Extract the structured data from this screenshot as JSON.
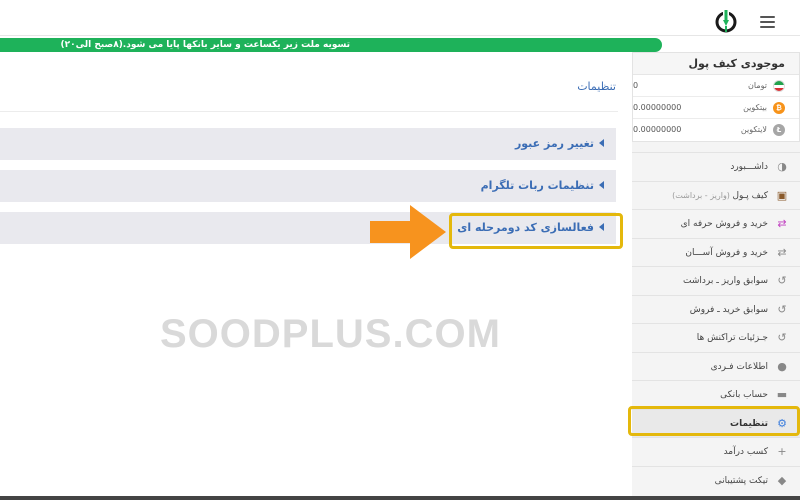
{
  "banner": {
    "text": "تسویه ملت زیر یکساعت و سایر بانکها پایا می شود.(۸صبح الی۲۰)",
    "color": "#1eb25a"
  },
  "header": {
    "logo_icon": "coin-plug-logo-icon",
    "menu_icon": "hamburger-menu-icon"
  },
  "wallet": {
    "title": "موجودی کیف پول",
    "currencies": [
      {
        "name": "تومان",
        "value": "0",
        "icon": "iran-flag-icon"
      },
      {
        "name": "بیتکوین",
        "value": "0.00000000",
        "icon": "bitcoin-icon"
      },
      {
        "name": "لایتکوین",
        "value": "0.00000000",
        "icon": "litecoin-icon"
      }
    ]
  },
  "sidebar": {
    "items": [
      {
        "label": "داشـــبورد",
        "sub": "",
        "icon": "dashboard-icon"
      },
      {
        "label": "کیف پـول",
        "sub": " (واریز - برداشت)",
        "icon": "wallet-icon"
      },
      {
        "label": "خرید و فروش حرفه ای",
        "sub": "",
        "icon": "exchange-pro-icon"
      },
      {
        "label": "خرید و فروش آســـان",
        "sub": "",
        "icon": "exchange-easy-icon"
      },
      {
        "label": "سوابق واریز ـ برداشت",
        "sub": "",
        "icon": "history-icon"
      },
      {
        "label": "سوابق خرید ـ فروش",
        "sub": "",
        "icon": "history-icon"
      },
      {
        "label": "جـزئیات تراکنش ها",
        "sub": "",
        "icon": "history-icon"
      },
      {
        "label": "اطلاعات فـردی",
        "sub": "",
        "icon": "user-icon"
      },
      {
        "label": "حساب بانکی",
        "sub": "",
        "icon": "bank-folder-icon"
      },
      {
        "label": "تنظیمات",
        "sub": "",
        "icon": "gear-icon",
        "active": true
      },
      {
        "label": "کسب درآمد",
        "sub": "",
        "icon": "add-user-icon"
      },
      {
        "label": "تیکت پشتیبانی",
        "sub": "",
        "icon": "tag-icon"
      }
    ]
  },
  "main": {
    "title": "تنظیمات",
    "sections": [
      {
        "label": "تغییر رمز عبور"
      },
      {
        "label": "تنظیمات ربات تلگرام"
      },
      {
        "label": "فعالسازی کد دومرحله ای"
      }
    ]
  },
  "watermark": "SOODPLUS.COM",
  "colors": {
    "accent": "#3b6db5",
    "highlight": "#e4b80c",
    "arrow": "#f7931e"
  }
}
